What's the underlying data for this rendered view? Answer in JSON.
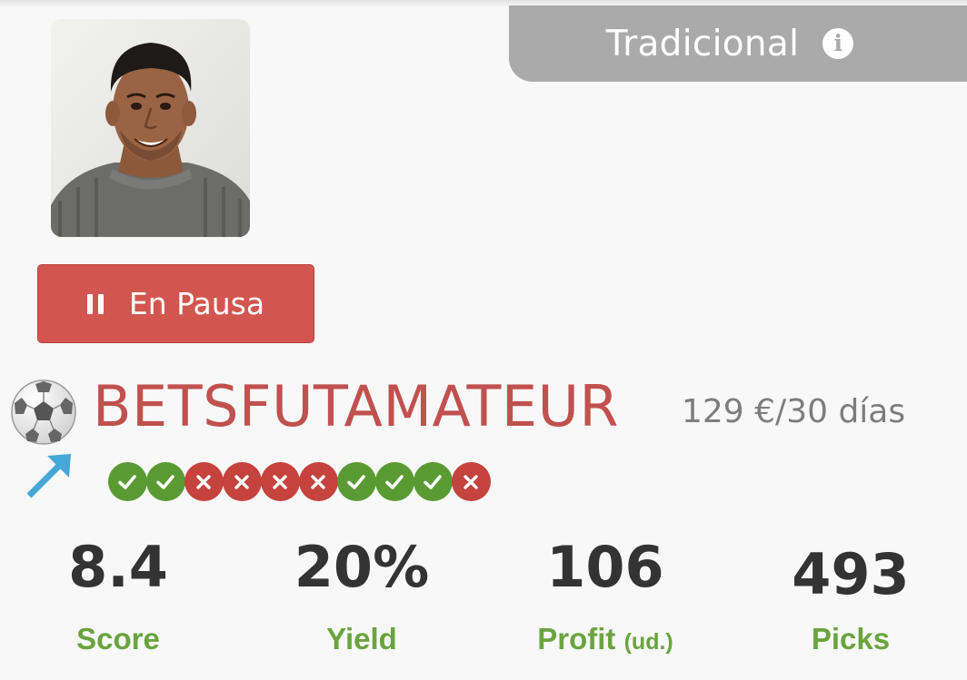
{
  "tab": {
    "label": "Tradicional",
    "icon": "info-icon"
  },
  "status_button": {
    "label": "En Pausa",
    "icon": "pause-icon"
  },
  "tipster": {
    "name": "BETSFUTAMATEUR",
    "price": "129 €/30 días",
    "sport_icon": "soccer-ball-icon",
    "trend_icon": "trend-up-arrow-icon"
  },
  "recent_results": [
    "win",
    "win",
    "loss",
    "loss",
    "loss",
    "loss",
    "win",
    "win",
    "win",
    "loss"
  ],
  "stats": [
    {
      "value": "8.4",
      "label": "Score",
      "unit": ""
    },
    {
      "value": "20%",
      "label": "Yield",
      "unit": ""
    },
    {
      "value": "106",
      "label": "Profit",
      "unit": "(ud.)"
    },
    {
      "value": "493",
      "label": "Picks",
      "unit": ""
    }
  ],
  "colors": {
    "accent_red": "#c0514e",
    "button_red": "#d2564f",
    "win_green": "#5a9a33",
    "loss_red": "#c5423d",
    "stat_label_green": "#6aa43e",
    "tab_gray": "#aaaaaa"
  }
}
